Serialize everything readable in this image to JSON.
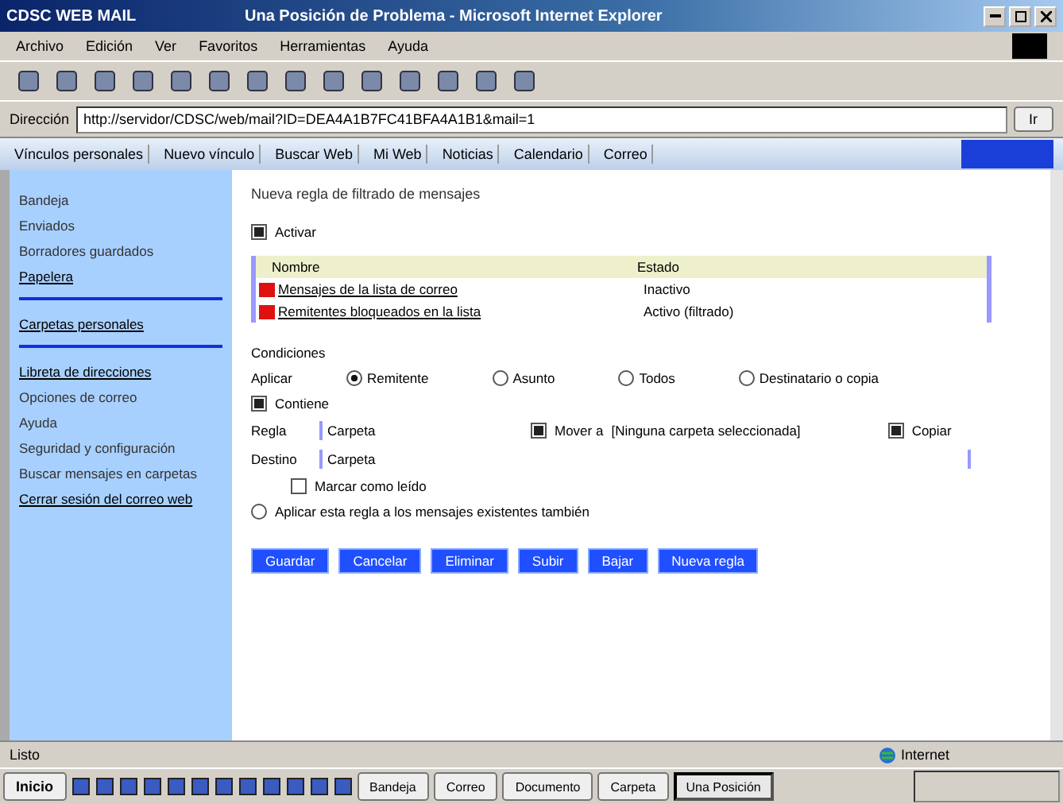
{
  "window": {
    "title": "Una Posición de Problema - Microsoft Internet Explorer",
    "app_name": "CDSC WEB MAIL"
  },
  "menu": [
    "Archivo",
    "Edición",
    "Ver",
    "Favoritos",
    "Herramientas",
    "Ayuda"
  ],
  "address": {
    "label": "Dirección",
    "value": "http://servidor/CDSC/web/mail?ID=DEA4A1B7FC41BFA4A1B1&mail=1",
    "go": "Ir"
  },
  "links": [
    "Vínculos personales",
    "Nuevo vínculo",
    "Buscar Web",
    "Mi Web",
    "Noticias",
    "Calendario",
    "Correo"
  ],
  "sidebar": {
    "groups": [
      {
        "items": [
          {
            "label": "Bandeja",
            "kind": "text"
          },
          {
            "label": "Enviados",
            "kind": "text"
          },
          {
            "label": "Borradores guardados",
            "kind": "text"
          },
          {
            "label": "Papelera",
            "kind": "link"
          }
        ]
      },
      {
        "items": [
          {
            "label": "Carpetas personales",
            "kind": "link"
          }
        ]
      },
      {
        "items": [
          {
            "label": "Libreta de direcciones",
            "kind": "link"
          },
          {
            "label": "Opciones de correo",
            "kind": "text"
          },
          {
            "label": "Ayuda",
            "kind": "text"
          },
          {
            "label": "Seguridad y configuración",
            "kind": "text"
          },
          {
            "label": "Buscar mensajes en carpetas",
            "kind": "text"
          },
          {
            "label": "Cerrar sesión del correo web",
            "kind": "link"
          }
        ]
      }
    ]
  },
  "main": {
    "heading": "Nueva regla de filtrado de mensajes",
    "enabled": {
      "label": "Activar",
      "checked": true
    },
    "table": {
      "columns": [
        "Nombre",
        "Estado"
      ],
      "rows": [
        {
          "name": "Mensajes de la lista de correo",
          "status": "Inactivo"
        },
        {
          "name": "Remitentes bloqueados en la lista",
          "status": "Activo (filtrado)"
        }
      ]
    },
    "section_label": "Condiciones",
    "match": {
      "label": "Aplicar",
      "options": [
        {
          "label": "Remitente",
          "selected": true
        },
        {
          "label": "Asunto",
          "selected": false
        },
        {
          "label": "Todos",
          "selected": false
        },
        {
          "label": "Destinatario o copia",
          "selected": false
        }
      ]
    },
    "contains": {
      "label": "Contiene",
      "checked": true
    },
    "rule_row": {
      "label": "Regla",
      "value": "Carpeta",
      "option1": {
        "label": "Mover a",
        "hint": "[Ninguna carpeta seleccionada]",
        "checked": true
      },
      "option2": {
        "label": "Copiar",
        "checked": true
      }
    },
    "folder_row": {
      "label": "Destino",
      "value": "Carpeta"
    },
    "sub_option": {
      "label": "Marcar como leído",
      "checked": false
    },
    "radio_all": {
      "label": "Aplicar esta regla a los mensajes existentes también",
      "selected": false
    },
    "buttons": [
      "Guardar",
      "Cancelar",
      "Eliminar",
      "Subir",
      "Bajar",
      "Nueva regla"
    ]
  },
  "status_bar": {
    "text": "Listo",
    "zone": "Internet"
  },
  "taskbar": {
    "start": "Inicio",
    "tasks": [
      "Bandeja",
      "Correo",
      "Documento",
      "Carpeta",
      "Una Posición"
    ]
  }
}
